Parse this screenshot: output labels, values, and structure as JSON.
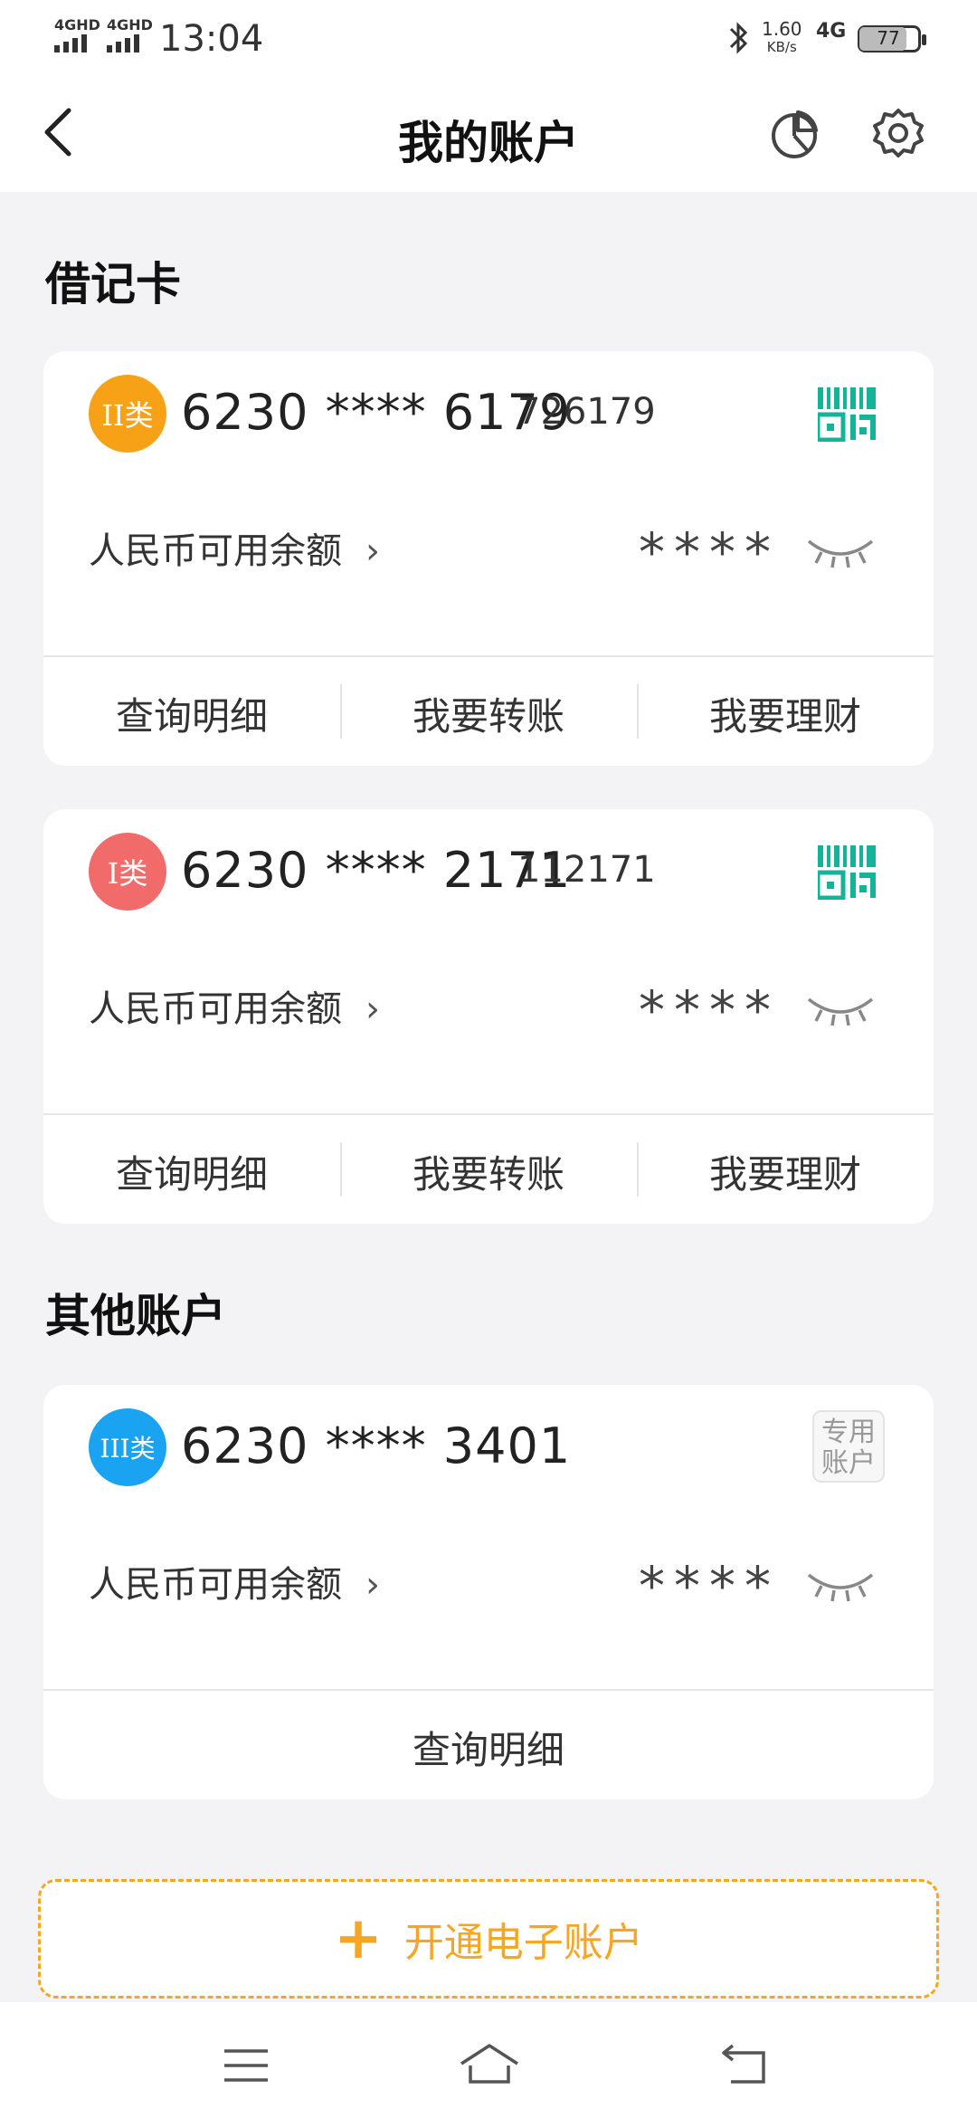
{
  "status": {
    "sim1": "4GHD",
    "sim2": "4GHD",
    "time": "13:04",
    "speed_value": "1.60",
    "speed_unit": "KB/s",
    "network": "4G",
    "battery": "77"
  },
  "header": {
    "title": "我的账户"
  },
  "sections": {
    "debit": "借记卡",
    "other": "其他账户"
  },
  "cards": [
    {
      "badge": "II类",
      "badge_color": "#f7a216",
      "number": "6230 **** 6179",
      "suffix": "726179",
      "balance_label": "人民币可用余额",
      "balance_mask": "****",
      "actions": [
        "查询明细",
        "我要转账",
        "我要理财"
      ]
    },
    {
      "badge": "I类",
      "badge_color": "#f26b6b",
      "number": "6230 **** 2171",
      "suffix": "112171",
      "balance_label": "人民币可用余额",
      "balance_mask": "****",
      "actions": [
        "查询明细",
        "我要转账",
        "我要理财"
      ]
    },
    {
      "badge": "III类",
      "badge_color": "#1aa3f0",
      "number": "6230 **** 3401",
      "special_tag": "专用账户",
      "balance_label": "人民币可用余额",
      "balance_mask": "****",
      "actions": [
        "查询明细"
      ]
    }
  ],
  "open_account": {
    "label": "开通电子账户",
    "color": "#f5a623"
  },
  "icons": {
    "back": "chevron-left-icon",
    "stats": "pie-chart-icon",
    "settings": "gear-icon",
    "qr": "qr-code-icon",
    "eye": "eye-closed-icon",
    "menu": "menu-icon",
    "home": "home-icon",
    "return": "back-nav-icon"
  }
}
